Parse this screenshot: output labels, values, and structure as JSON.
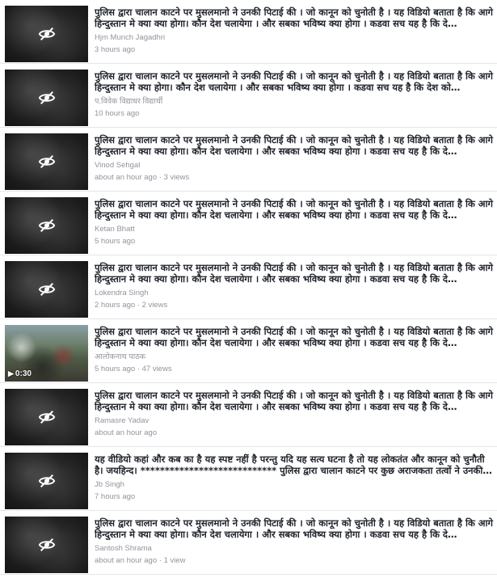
{
  "items": [
    {
      "title": "पुलिस द्वारा चालान काटने पर मुसलमानो ने उनकी पिटाई की । जो कानून को चुनोती है । यह विडियो बताता है कि आगे हिन्दुस्तान मे क्या क्या होगा। कौन देश चलायेगा । और सबका भविष्य क्या होगा । कडवा सच यह है कि दे…",
      "author": "Hjm Munch Jagadhri",
      "time": "3 hours ago",
      "thumbnail": "hidden"
    },
    {
      "title": "पुलिस द्वारा चालान काटने पर मुसलमानो ने उनकी पिटाई की । जो कानून को चुनोती है । यह विडियो बताता है कि आगे हिन्दुस्तान मे क्या होगा। कौन देश चलायेगा । और सबका भविष्य क्या होगा । कडवा सच यह है कि देश को…",
      "author": "प.विवेक विद्याधर विद्यार्थी",
      "time": "10 hours ago",
      "thumbnail": "hidden"
    },
    {
      "title": "पुलिस द्वारा चालान काटने पर मुसलमानो ने उनकी पिटाई की । जो कानून को चुनोती है । यह विडियो बताता है कि आगे हिन्दुस्तान मे क्या क्या होगा। कौन देश चलायेगा । और सबका भविष्य क्या होगा । कडवा सच यह है कि दे…",
      "author": "Vinod Sehgal",
      "time": "about an hour ago · 3 views",
      "thumbnail": "hidden"
    },
    {
      "title": "पुलिस द्वारा चालान काटने पर मुसलमानो ने उनकी पिटाई की । जो कानून को चुनोती है । यह विडियो बताता है कि आगे हिन्दुस्तान मे क्या क्या होगा। कौन देश चलायेगा । और सबका भविष्य क्या होगा । कडवा सच यह है कि दे…",
      "author": "Ketan Bhatt",
      "time": "5 hours ago",
      "thumbnail": "hidden"
    },
    {
      "title": "पुलिस द्वारा चालान काटने पर मुसलमानो ने उनकी पिटाई की । जो कानून को चुनोती है । यह विडियो बताता है कि आगे हिन्दुस्तान मे क्या क्या होगा। कौन देश चलायेगा । और सबका भविष्य क्या होगा । कडवा सच यह है कि दे…",
      "author": "Lokendra Singh",
      "time": "2 hours ago · 2 views",
      "thumbnail": "hidden"
    },
    {
      "title": "पुलिस द्वारा चालान काटने पर मुसलमानो ने उनकी पिटाई की । जो कानून को चुनोती है । यह विडियो बताता है कि आगे हिन्दुस्तान मे क्या क्या होगा। कौन देश चलायेगा । और सबका भविष्य क्या होगा । कडवा सच यह है कि दे…",
      "author": "आलोकनाथ पाठक",
      "time": "5 hours ago · 47 views",
      "thumbnail": "photo",
      "duration": "0:30"
    },
    {
      "title": "पुलिस द्वारा चालान काटने पर मुसलमानो ने उनकी पिटाई की । जो कानून को चुनोती है । यह विडियो बताता है कि आगे हिन्दुस्तान मे क्या क्या होगा। कौन देश चलायेगा । और सबका भविष्य क्या होगा । कडवा सच यह है कि दे…",
      "author": "Ramasre Yadav",
      "time": "about an hour ago",
      "thumbnail": "hidden"
    },
    {
      "title": "यह वीडियो कहां और कब का है यह स्पष्ट नहीं है परन्तु यदि यह सत्य घटना है तो यह लोकतंत और कानून को चुनौती है। जयहिन्द। **************************** पुलिस द्वारा चालान काटने पर कुछ अराजकता तत्वों ने उनकी…",
      "author": "Jb Singh",
      "time": "7 hours ago",
      "thumbnail": "hidden"
    },
    {
      "title": "पुलिस द्वारा चालान काटने पर मुसलमानो ने उनकी पिटाई की । जो कानून को चुनोती है । यह विडियो बताता है कि आगे हिन्दुस्तान मे क्या क्या होगा। कौन देश चलायेगा । और सबका भविष्य क्या होगा । कडवा सच यह है कि दे…",
      "author": "Santosh Shrama",
      "time": "about an hour ago · 1 view",
      "thumbnail": "hidden"
    }
  ],
  "icons": {
    "hidden": "eye-slash-icon",
    "play": "play-icon"
  },
  "colors": {
    "title": "#1d2129",
    "meta": "#90949c",
    "divider": "#e4e6eb"
  }
}
